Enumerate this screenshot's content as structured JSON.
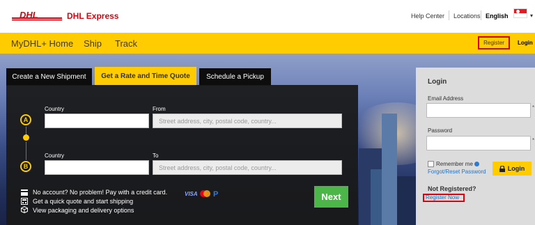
{
  "header": {
    "brand": "DHL Express",
    "help_center": "Help Center",
    "locations": "Locations",
    "language": "English",
    "flag_icon": "singapore-flag-icon"
  },
  "nav": {
    "items": [
      "MyDHL+ Home",
      "Ship",
      "Track"
    ],
    "register": "Register",
    "login": "Login"
  },
  "tabs": [
    {
      "label": "Create a New Shipment",
      "active": false
    },
    {
      "label": "Get a Rate and Time Quote",
      "active": true
    },
    {
      "label": "Schedule a Pickup",
      "active": false
    }
  ],
  "quote_form": {
    "origin": {
      "pin": "A",
      "country_label": "Country",
      "country_value": "",
      "address_label": "From",
      "address_placeholder": "Street address, city, postal code, country..."
    },
    "destination": {
      "pin": "B",
      "country_label": "Country",
      "country_value": "",
      "address_label": "To",
      "address_placeholder": "Street address, city, postal code, country..."
    },
    "info": [
      "No account? No problem! Pay with a credit card.",
      "Get a quick quote and start shipping",
      "View packaging and delivery options"
    ],
    "next_button": "Next",
    "payment_icons": [
      "visa-icon",
      "mastercard-icon",
      "paypal-icon"
    ]
  },
  "login_panel": {
    "title": "Login",
    "email_label": "Email Address",
    "email_value": "",
    "password_label": "Password",
    "password_value": "",
    "remember_me": "Remember me",
    "forgot": "Forgot/Reset Password",
    "login_button": "Login",
    "not_registered": "Not Registered?",
    "register_now": "Register Now"
  },
  "colors": {
    "dhl_yellow": "#fecc00",
    "dhl_red": "#d40511",
    "next_green": "#4cb748",
    "link_blue": "#2473c4"
  }
}
